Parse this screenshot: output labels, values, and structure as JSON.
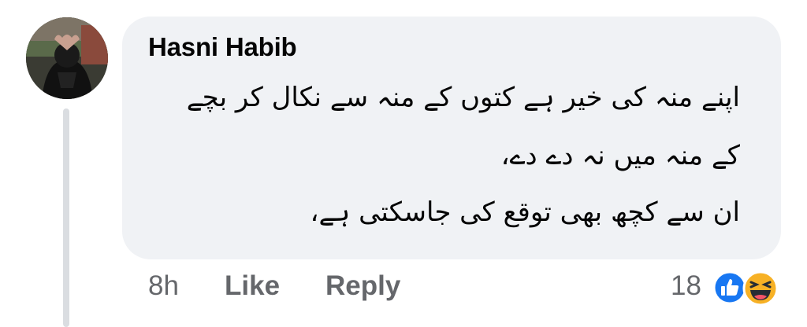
{
  "comment": {
    "author": "Hasni Habib",
    "lines": [
      "اپنے منہ کی خیر ہے کتوں کے منہ سے نکال کر بچے",
      "کے منہ میں نہ دے دے،",
      "ان سے کچھ بھی توقع کی جاسکتی ہے،"
    ]
  },
  "actions": {
    "time": "8h",
    "like": "Like",
    "reply": "Reply"
  },
  "reactions": {
    "count": "18",
    "icons": [
      "like-reaction-icon",
      "haha-reaction-icon"
    ],
    "like_color": "#1877f2",
    "haha_color": "#f7b125"
  }
}
